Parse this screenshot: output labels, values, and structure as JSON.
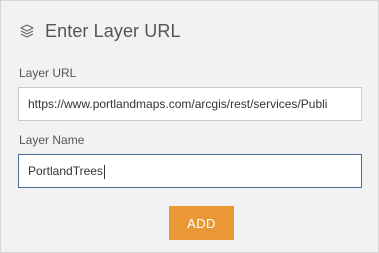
{
  "dialog": {
    "title": "Enter Layer URL",
    "title_icon": "layers-icon"
  },
  "fields": {
    "url": {
      "label": "Layer URL",
      "value": "https://www.portlandmaps.com/arcgis/rest/services/Publi"
    },
    "name": {
      "label": "Layer Name",
      "value": "PortlandTrees"
    }
  },
  "actions": {
    "add_label": "ADD"
  },
  "colors": {
    "panel_background": "#f2f2f2",
    "accent_button": "#ea9736",
    "focused_input_border": "#4a6e93"
  }
}
